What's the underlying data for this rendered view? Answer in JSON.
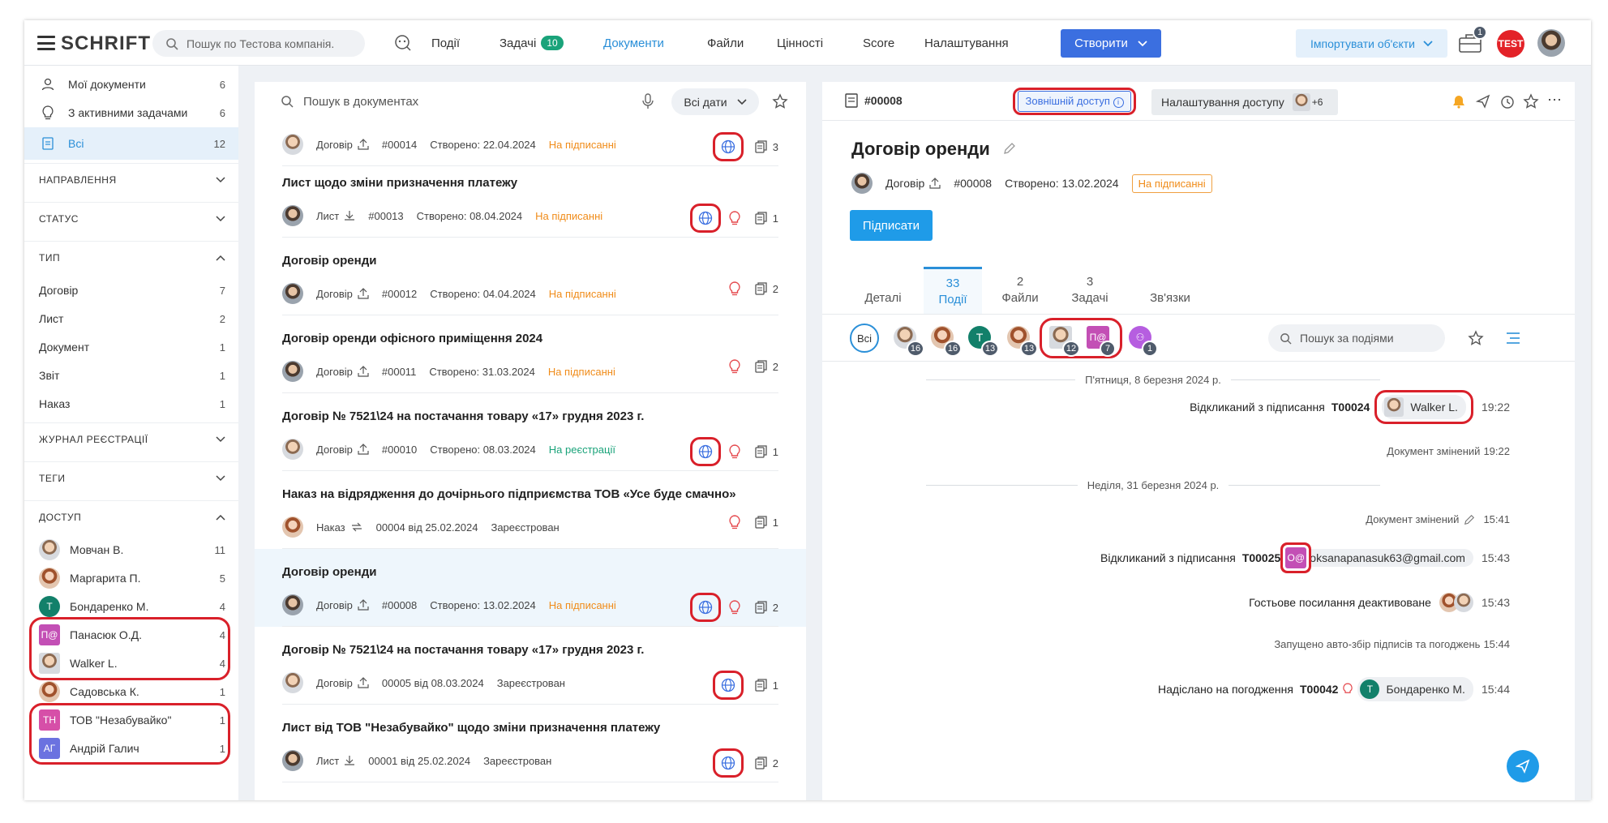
{
  "topbar": {
    "logo": "SCHRIFT",
    "search_placeholder": "Пошук по Тестова компанія.",
    "nav": [
      {
        "label": "Події"
      },
      {
        "label": "Задачі",
        "badge": "10"
      },
      {
        "label": "Документи",
        "active": true
      },
      {
        "label": "Файли"
      },
      {
        "label": "Цінності"
      },
      {
        "label": "Score"
      },
      {
        "label": "Налаштування"
      }
    ],
    "create_label": "Створити",
    "import_label": "Імпортувати об'єкти",
    "briefcase_badge": "1",
    "test_logo": "TEST"
  },
  "sidebar": {
    "top": [
      {
        "label": "Мої документи",
        "count": "6",
        "icon": "person-icon"
      },
      {
        "label": "З активними задачами",
        "count": "6",
        "icon": "bulb-icon"
      },
      {
        "label": "Всі",
        "count": "12",
        "icon": "document-icon"
      }
    ],
    "sections": {
      "direction": "НАПРАВЛЕННЯ",
      "status": "СТАТУС",
      "type": "ТИП",
      "journal": "ЖУРНАЛ РЕЄСТРАЦІЇ",
      "tags": "ТЕГИ",
      "access": "ДОСТУП"
    },
    "types": [
      {
        "label": "Договір",
        "count": "7"
      },
      {
        "label": "Лист",
        "count": "2"
      },
      {
        "label": "Документ",
        "count": "1"
      },
      {
        "label": "Звіт",
        "count": "1"
      },
      {
        "label": "Наказ",
        "count": "1"
      }
    ],
    "access": [
      {
        "label": "Мовчан В.",
        "count": "11",
        "avatar": "photo"
      },
      {
        "label": "Маргарита П.",
        "count": "5",
        "avatar": "photo2"
      },
      {
        "label": "Бондаренко М.",
        "count": "4",
        "initials": "Т",
        "color": "#12806a"
      },
      {
        "label": "Панасюк О.Д.",
        "count": "4",
        "initials": "П@",
        "color": "#c34fb5"
      },
      {
        "label": "Walker L.",
        "count": "4",
        "avatar": "photo"
      },
      {
        "label": "Садовська К.",
        "count": "1",
        "avatar": "photo2"
      },
      {
        "label": "ТОВ \"Незабувайко\"",
        "count": "1",
        "initials": "ТН",
        "color": "#d64fa8"
      },
      {
        "label": "Андрій Галич",
        "count": "1",
        "initials": "АГ",
        "color": "#6b72e0"
      }
    ]
  },
  "list": {
    "search_placeholder": "Пошук в документах",
    "dates_label": "Всі дати",
    "items": [
      {
        "title": "",
        "type": "Договір",
        "num": "#00014",
        "created": "Створено: 22.04.2024",
        "status": "На підписанні",
        "status_color": "orange",
        "globe": true,
        "bulb": false,
        "files": "3"
      },
      {
        "title": "Лист щодо зміни призначення платежу",
        "type": "Лист",
        "num": "#00013",
        "created": "Створено: 08.04.2024",
        "status": "На підписанні",
        "status_color": "orange",
        "globe": true,
        "bulb": true,
        "files": "1"
      },
      {
        "title": "Договір оренди",
        "type": "Договір",
        "num": "#00012",
        "created": "Створено: 04.04.2024",
        "status": "На підписанні",
        "status_color": "orange",
        "globe": false,
        "bulb": true,
        "files": "2"
      },
      {
        "title": "Договір оренди офісного приміщення 2024",
        "type": "Договір",
        "num": "#00011",
        "created": "Створено: 31.03.2024",
        "status": "На підписанні",
        "status_color": "orange",
        "globe": false,
        "bulb": true,
        "files": "2"
      },
      {
        "title": "Договір № 7521\\24 на постачання товару «17» грудня 2023 г.",
        "type": "Договір",
        "num": "#00010",
        "created": "Створено: 08.03.2024",
        "status": "На реєстрації",
        "status_color": "green",
        "globe": true,
        "bulb": true,
        "files": "1"
      },
      {
        "title": "Наказ на відрядження до дочірнього підприємства ТОВ «Усе буде смачно»",
        "type": "Наказ",
        "num": "00004 від 25.02.2024",
        "created": "",
        "status": "Зареєстрован",
        "status_color": "gray",
        "globe": false,
        "bulb": true,
        "files": "1"
      },
      {
        "title": "Договір оренди",
        "type": "Договір",
        "num": "#00008",
        "created": "Створено: 13.02.2024",
        "status": "На підписанні",
        "status_color": "orange",
        "globe": true,
        "bulb": true,
        "files": "2",
        "selected": true
      },
      {
        "title": "Договір № 7521\\24 на постачання товару «17» грудня 2023 г.",
        "type": "Договір",
        "num": "00005 від 08.03.2024",
        "created": "",
        "status": "Зареєстрован",
        "status_color": "gray",
        "globe": true,
        "bulb": false,
        "files": "1"
      },
      {
        "title": "Лист від ТОВ \"Незабувайко\" щодо зміни призначення платежу",
        "type": "Лист",
        "num": "00001 від 25.02.2024",
        "created": "",
        "status": "Зареєстрован",
        "status_color": "gray",
        "globe": true,
        "bulb": false,
        "files": "2"
      }
    ]
  },
  "detail": {
    "num": "#00008",
    "external_access": "Зовнішній доступ",
    "access_settings": "Налаштування доступу",
    "access_extra": "+6",
    "title": "Договір оренди",
    "meta_type": "Договір",
    "meta_num": "#00008",
    "meta_created": "Створено: 13.02.2024",
    "meta_status": "На підписанні",
    "sign_label": "Підписати",
    "tabs": [
      {
        "count": "",
        "label": "Деталі"
      },
      {
        "count": "33",
        "label": "Події"
      },
      {
        "count": "2",
        "label": "Файли"
      },
      {
        "count": "3",
        "label": "Задачі"
      },
      {
        "count": "",
        "label": "Зв'язки"
      }
    ],
    "filter_all": "Всі",
    "filter_counts": [
      "16",
      "16",
      "13",
      "13",
      "12",
      "7",
      "1"
    ],
    "filter_t": "Т",
    "filter_p": "П@",
    "events_search": "Пошук за подіями",
    "day1": "П'ятниця, 8 березня 2024 р.",
    "day2": "Неділя, 31 березня 2024 р.",
    "events": [
      {
        "text": "Відкликаний з підписання",
        "code": "T00024",
        "who": "Walker L.",
        "time": "19:22"
      },
      {
        "text": "Документ змінений",
        "time": "19:22"
      },
      {
        "text": "Документ змінений",
        "time": "15:41"
      },
      {
        "text": "Відкликаний з підписання",
        "code": "T00025",
        "who": "oksanapanasuk63@gmail.com",
        "who_initials": "О@",
        "time": "15:43"
      },
      {
        "text": "Гостьове посилання деактивоване",
        "time": "15:43"
      },
      {
        "text": "Запущено авто-збір підписів та погоджень",
        "time": "15:44"
      },
      {
        "text": "Надіслано на погодження",
        "code": "T00042",
        "who": "Бондаренко М.",
        "who_initials": "Т",
        "time": "15:44"
      }
    ]
  }
}
